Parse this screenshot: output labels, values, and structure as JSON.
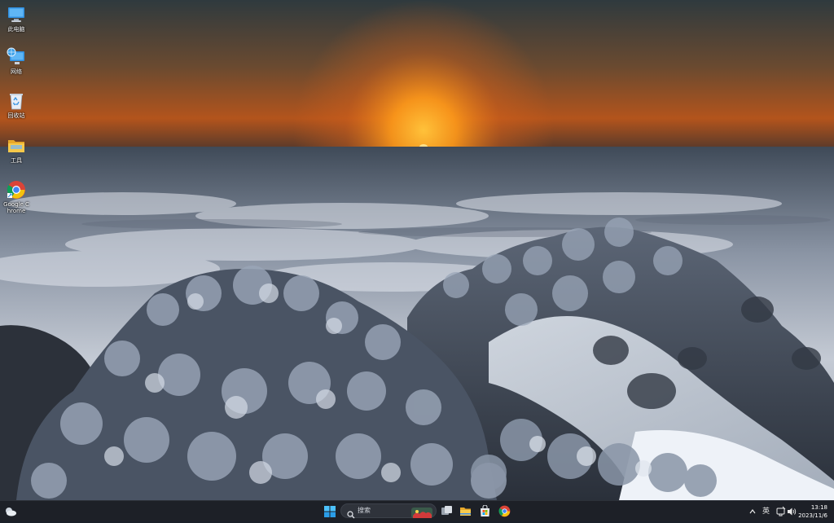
{
  "desktop": {
    "icons": [
      {
        "label": "此电脑",
        "icon": "this-pc-icon"
      },
      {
        "label": "网络",
        "icon": "network-icon"
      },
      {
        "label": "回收站",
        "icon": "recycle-bin-icon"
      },
      {
        "label": "工具",
        "icon": "folder-icon"
      },
      {
        "label": "Google Chrome",
        "icon": "chrome-icon"
      }
    ]
  },
  "taskbar": {
    "search_placeholder": "搜索",
    "pinned": [
      "start-icon",
      "search-icon",
      "task-view-icon",
      "file-explorer-icon",
      "microsoft-store-icon",
      "chrome-icon"
    ],
    "tray": {
      "language": "英",
      "time": "13:18",
      "date": "2023/11/6"
    }
  },
  "colors": {
    "taskbar_bg": "#1d2027",
    "accent_blue": "#3b8eea",
    "sun": "#ffb21a"
  }
}
